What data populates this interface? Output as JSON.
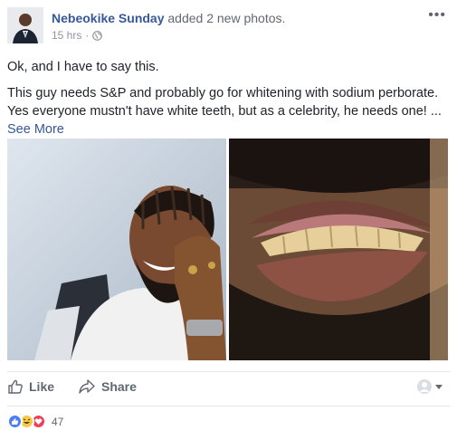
{
  "post": {
    "author": "Nebeokike Sunday",
    "action_text": " added 2 new photos.",
    "timestamp": "15 hrs",
    "separator": " · ",
    "more_label": "•••",
    "paragraphs": [
      "Ok, and I have to say this.",
      "This guy needs S&P and probably go for whitening with sodium perborate. Yes everyone mustn't have white teeth, but as a celebrity, he needs one! ..."
    ],
    "see_more": "See More",
    "photos": [
      {
        "description_icon": "photo-laughing-man"
      },
      {
        "description_icon": "photo-closeup-teeth"
      }
    ]
  },
  "actions": {
    "like_label": "Like",
    "share_label": "Share"
  },
  "reactions": {
    "count": "47",
    "types": [
      "like",
      "haha",
      "love"
    ]
  },
  "colors": {
    "link": "#365899",
    "meta": "#90949c",
    "action": "#606770"
  }
}
